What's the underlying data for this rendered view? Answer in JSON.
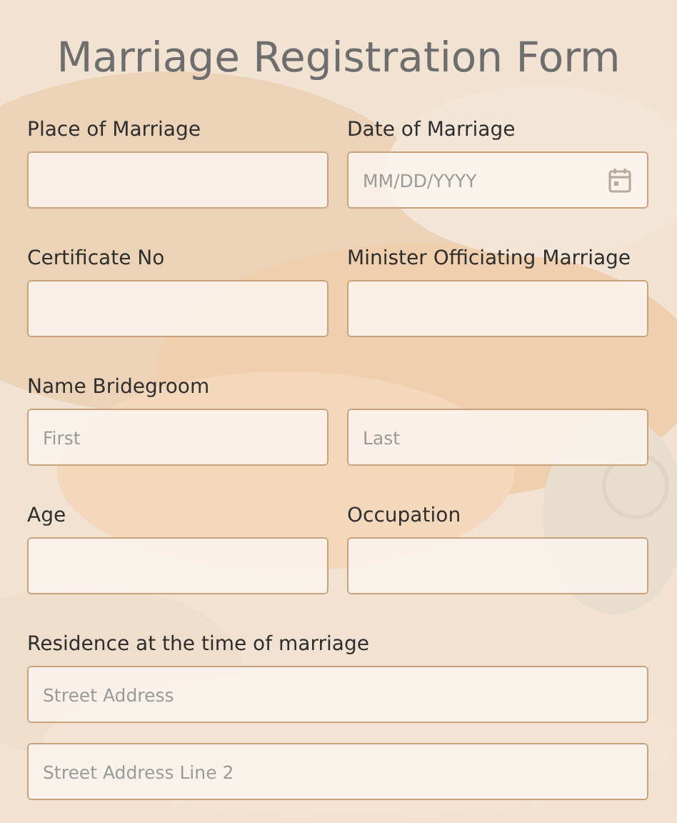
{
  "title": "Marriage Registration Form",
  "groups": [
    {
      "kind": "half",
      "label": "Place of Marriage",
      "inputs": [
        {
          "kind": "text"
        }
      ]
    },
    {
      "kind": "half",
      "label": "Date of Marriage",
      "inputs": [
        {
          "kind": "date",
          "placeholder": "MM/DD/YYYY"
        }
      ]
    },
    {
      "kind": "half",
      "label": "Certificate No",
      "inputs": [
        {
          "kind": "text"
        }
      ]
    },
    {
      "kind": "half",
      "label": "Minister Officiating Marriage",
      "inputs": [
        {
          "kind": "text"
        }
      ]
    },
    {
      "kind": "pair",
      "label": "Name Bridegroom",
      "inputs": [
        {
          "kind": "text",
          "placeholder": "First"
        },
        {
          "kind": "text",
          "placeholder": "Last"
        }
      ]
    },
    {
      "kind": "half",
      "label": "Age",
      "inputs": [
        {
          "kind": "text"
        }
      ]
    },
    {
      "kind": "half",
      "label": "Occupation",
      "inputs": [
        {
          "kind": "text"
        }
      ]
    },
    {
      "kind": "stack",
      "label": "Residence at the time of marriage",
      "inputs": [
        {
          "kind": "text",
          "placeholder": "Street Address"
        },
        {
          "kind": "text",
          "placeholder": "Street Address Line 2"
        }
      ]
    }
  ]
}
